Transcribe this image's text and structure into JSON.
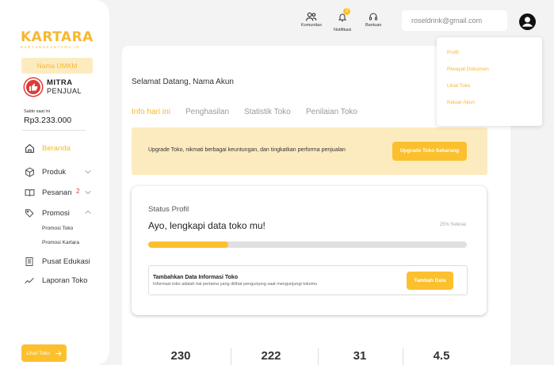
{
  "brand": {
    "name": "KARTARA",
    "subtitle": "KARYANUSANTARA.ID",
    "color": "#f7b731"
  },
  "sidebar": {
    "umkm_badge": "Nama UMKM",
    "mitra_line1": "MITRA",
    "mitra_line2": "PENJUAL",
    "saldo_label": "Saldo saat ini",
    "saldo_value": "Rp3.233.000",
    "nav": {
      "beranda": "Beranda",
      "produk": "Produk",
      "pesanan": "Pesanan",
      "pesanan_count": "2",
      "promosi": "Promosi",
      "promosi_toko": "Promosi Toko",
      "promosi_kartara": "Promosi Kartara",
      "pusat_edukasi": "Pusat Edukasi",
      "laporan_toko": "Laporan Toko"
    },
    "lihat_toko": "Lihat Toko"
  },
  "topbar": {
    "komunitas": "Komunitas",
    "notifikasi": "Notifikasi",
    "notif_count": "2",
    "bantuan": "Bantuan",
    "email": "roseldrink@gmail.com"
  },
  "dropdown": {
    "items": [
      "Profil",
      "Riwayat Dokumen",
      "Lihat Toko",
      "Keluar Akun"
    ]
  },
  "main": {
    "welcome": "Selamat Datang, Nama Akun",
    "tabs": [
      "Info hari ini",
      "Penghasilan",
      "Statistik Toko",
      "Penilaian Toko"
    ],
    "upgrade_text": "Upgrade Toko, nikmati berbagai keuntungan, dan tingkatkan performa penjualan",
    "upgrade_button": "Upgrade Toko Sekarang",
    "status": {
      "title": "Status Profil",
      "heading": "Ayo, lengkapi data toko mu!",
      "percent_label": "25% Selesai",
      "progress": 0.25,
      "info_title": "Tambahkan Data Informasi Toko",
      "info_desc": "Informasi toko adalah hal pertama yang dilihat pengunjung saat mengunjungi tokomu",
      "info_button": "Tambah Data"
    },
    "stats": [
      "230",
      "222",
      "31",
      "4.5"
    ]
  }
}
